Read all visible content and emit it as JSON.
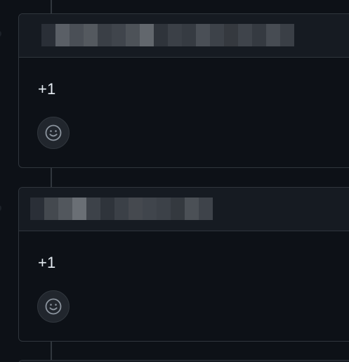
{
  "comments": [
    {
      "body": "+1",
      "reaction_icon": "smiley-icon"
    },
    {
      "body": "+1",
      "reaction_icon": "smiley-icon"
    }
  ],
  "colors": {
    "background": "#0d1117",
    "header": "#161b22",
    "border": "#30363d",
    "text": "#e6edf3",
    "reaction_bg": "#21262d"
  }
}
